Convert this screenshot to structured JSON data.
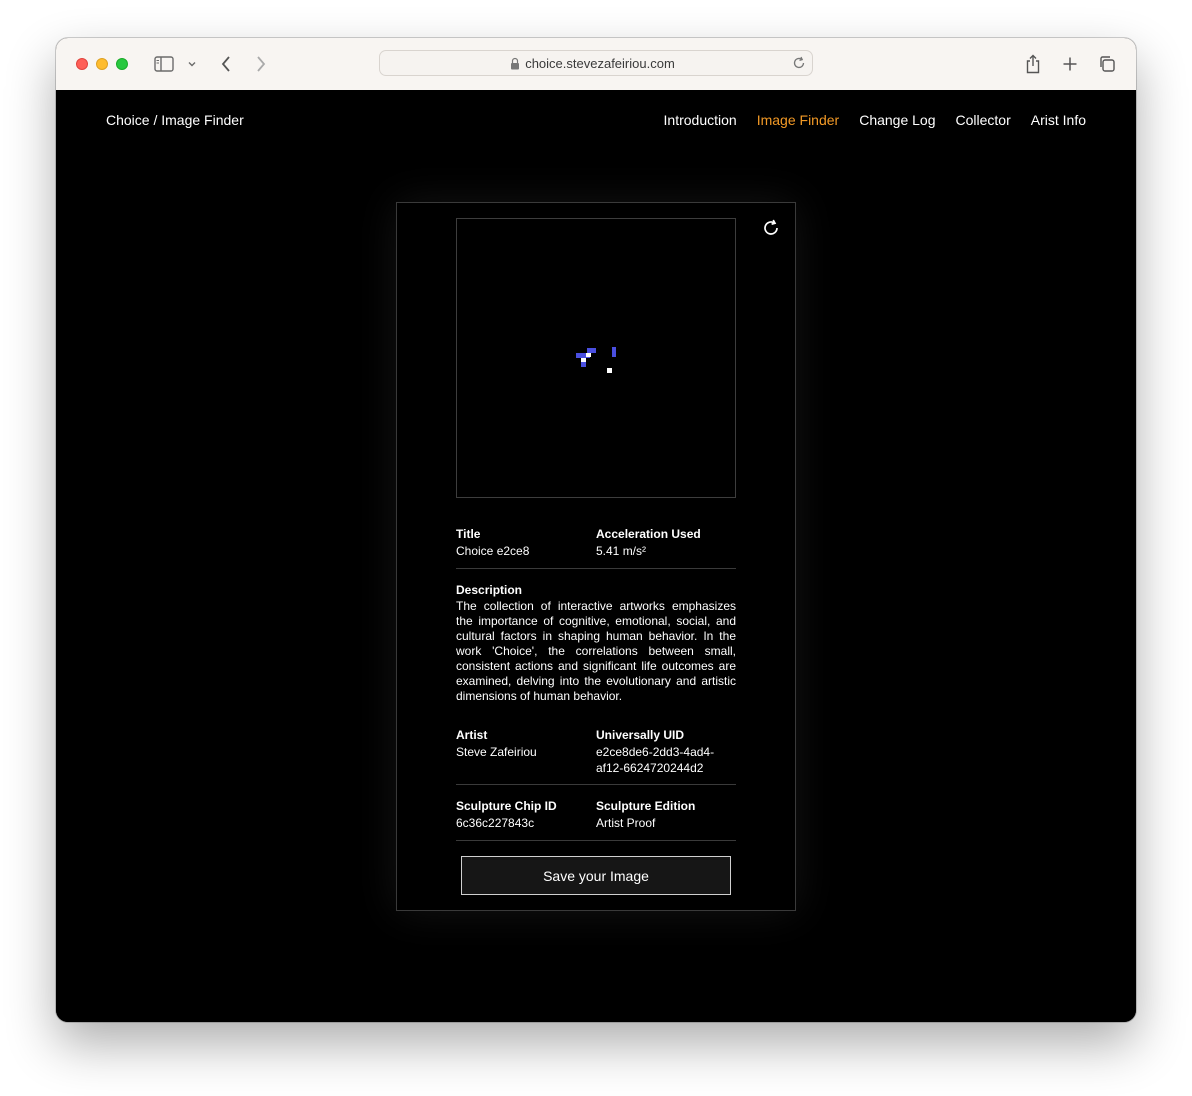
{
  "browser": {
    "url": "choice.stevezafeiriou.com"
  },
  "site": {
    "title": "Choice / Image Finder",
    "nav": [
      {
        "label": "Introduction",
        "active": false
      },
      {
        "label": "Image Finder",
        "active": true
      },
      {
        "label": "Change Log",
        "active": false
      },
      {
        "label": "Collector",
        "active": false
      },
      {
        "label": "Arist Info",
        "active": false
      }
    ],
    "accent_color": "#f39a26"
  },
  "card": {
    "artwork_colors": [
      "#4a4fe0",
      "#ffffff"
    ],
    "title_label": "Title",
    "title_value": "Choice e2ce8",
    "accel_label": "Acceleration Used",
    "accel_value": "5.41 m/s²",
    "desc_label": "Description",
    "desc_value": "The collection of interactive artworks emphasizes the importance of cognitive, emotional, social, and cultural factors in shaping human behavior. In the work 'Choice', the correlations between small, consistent actions and significant life outcomes are examined, delving into the evolutionary and artistic dimensions of human behavior.",
    "artist_label": "Artist",
    "artist_value": "Steve Zafeiriou",
    "uid_label": "Universally UID",
    "uid_line1": "e2ce8de6-2dd3-4ad4-",
    "uid_line2": "af12-6624720244d2",
    "chip_label": "Sculpture Chip ID",
    "chip_value": "6c36c227843c",
    "edition_label": "Sculpture Edition",
    "edition_value": "Artist Proof",
    "save_label": "Save your Image"
  }
}
